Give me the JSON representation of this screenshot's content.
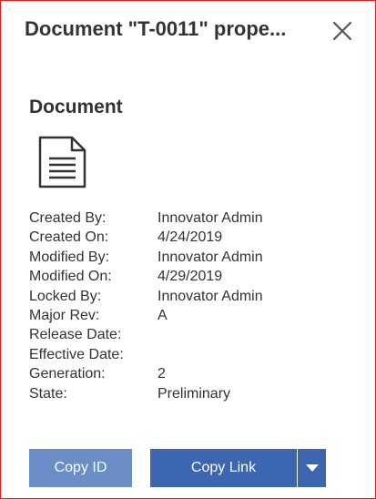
{
  "dialog": {
    "title": "Document \"T-0011\" prope...",
    "close_icon": "close-icon"
  },
  "section": {
    "heading": "Document",
    "icon": "document-icon"
  },
  "properties": [
    {
      "label": "Created By:",
      "value": "Innovator Admin"
    },
    {
      "label": "Created On:",
      "value": "4/24/2019"
    },
    {
      "label": "Modified By:",
      "value": "Innovator Admin"
    },
    {
      "label": "Modified On:",
      "value": "4/29/2019"
    },
    {
      "label": "Locked By:",
      "value": "Innovator Admin"
    },
    {
      "label": "Major Rev:",
      "value": "A"
    },
    {
      "label": "Release Date:",
      "value": ""
    },
    {
      "label": "Effective Date:",
      "value": ""
    },
    {
      "label": "Generation:",
      "value": "2"
    },
    {
      "label": "State:",
      "value": "Preliminary"
    }
  ],
  "buttons": {
    "copy_id": "Copy ID",
    "copy_link": "Copy Link",
    "dropdown_icon": "caret-down-icon"
  },
  "colors": {
    "border": "#e21b1b",
    "text": "#333333",
    "copy_id_bg": "#6b8ec6",
    "copy_link_bg": "#3d66b1"
  }
}
